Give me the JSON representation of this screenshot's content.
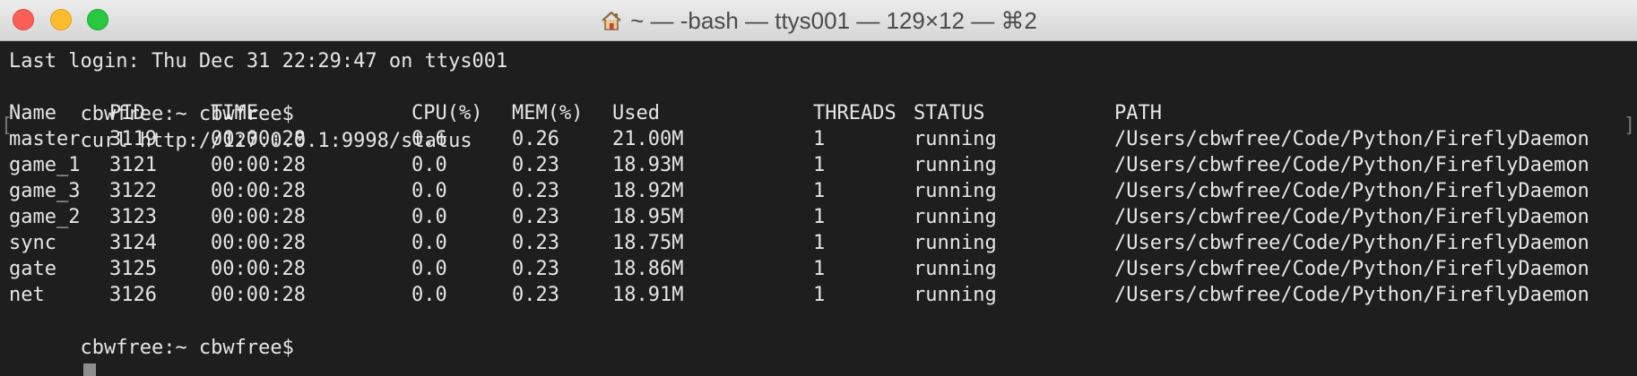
{
  "window": {
    "title": "~ — -bash — ttys001 — 129×12 — ⌘2",
    "icon": "home-icon"
  },
  "terminal": {
    "last_login": "Last login: Thu Dec 31 22:29:47 on ttys001",
    "command_prompt": "cbwfree:~ cbwfree$",
    "command": "curl http://127.0.0.1:9998/status",
    "bracket_left": "[",
    "bracket_right": "]",
    "headers": [
      "Name",
      "PID",
      "TIME",
      "CPU(%)",
      "MEM(%)",
      "Used",
      "THREADS",
      "STATUS",
      "PATH"
    ],
    "rows": [
      [
        "master",
        "3119",
        "00:00:28",
        "0.6",
        "0.26",
        "21.00M",
        "1",
        "running",
        "/Users/cbwfree/Code/Python/FireflyDaemon"
      ],
      [
        "game_1",
        "3121",
        "00:00:28",
        "0.0",
        "0.23",
        "18.93M",
        "1",
        "running",
        "/Users/cbwfree/Code/Python/FireflyDaemon"
      ],
      [
        "game_3",
        "3122",
        "00:00:28",
        "0.0",
        "0.23",
        "18.92M",
        "1",
        "running",
        "/Users/cbwfree/Code/Python/FireflyDaemon"
      ],
      [
        "game_2",
        "3123",
        "00:00:28",
        "0.0",
        "0.23",
        "18.95M",
        "1",
        "running",
        "/Users/cbwfree/Code/Python/FireflyDaemon"
      ],
      [
        "sync",
        "3124",
        "00:00:28",
        "0.0",
        "0.23",
        "18.75M",
        "1",
        "running",
        "/Users/cbwfree/Code/Python/FireflyDaemon"
      ],
      [
        "gate",
        "3125",
        "00:00:28",
        "0.0",
        "0.23",
        "18.86M",
        "1",
        "running",
        "/Users/cbwfree/Code/Python/FireflyDaemon"
      ],
      [
        "net",
        "3126",
        "00:00:28",
        "0.0",
        "0.23",
        "18.91M",
        "1",
        "running",
        "/Users/cbwfree/Code/Python/FireflyDaemon"
      ]
    ],
    "final_prompt": "cbwfree:~ cbwfree$"
  },
  "colors": {
    "background": "#1e1e1e",
    "text": "#e6e6e6",
    "cursor": "#8e8e8e",
    "close": "#fc5f57",
    "minimize": "#fdbc2e",
    "zoom": "#28c840"
  }
}
